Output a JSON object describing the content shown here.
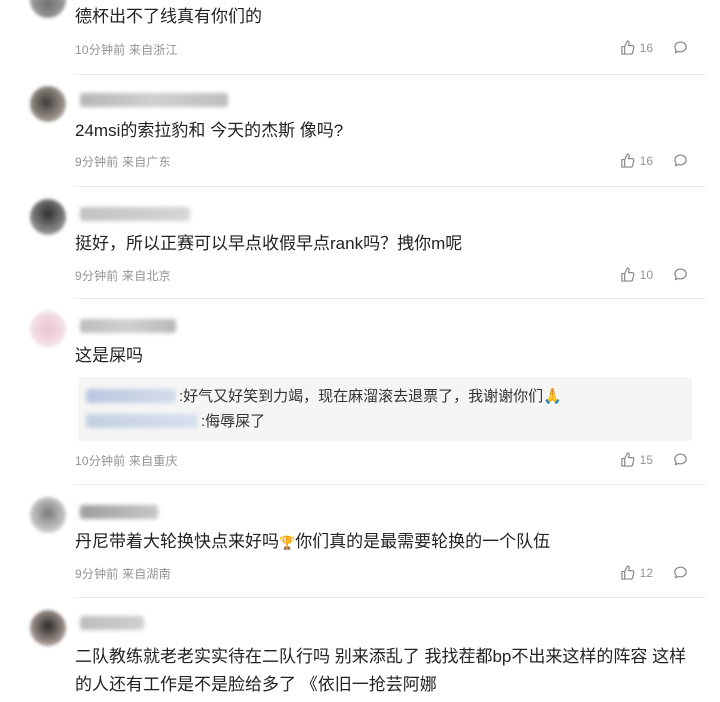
{
  "colors": {
    "meta_text": "#939393",
    "divider": "#ececec",
    "quote_bg": "#f5f5f5"
  },
  "icons": {
    "like": "thumbs-up-icon",
    "reply": "comment-bubble-icon"
  },
  "comments": [
    {
      "text": "德杯出不了线真有你们的",
      "time": "10分钟前",
      "location": "来自浙江",
      "likes": "16"
    },
    {
      "text": "24msi的索拉豹和 今天的杰斯 像吗?",
      "time": "9分钟前",
      "location": "来自广东",
      "likes": "16"
    },
    {
      "text": "挺好，所以正赛可以早点收假早点rank吗？拽你m呢",
      "time": "9分钟前",
      "location": "来自北京",
      "likes": "10"
    },
    {
      "text": "这是屎吗",
      "time": "10分钟前",
      "location": "来自重庆",
      "likes": "15",
      "replies": [
        {
          "text": ":好气又好笑到力竭，现在麻溜滚去退票了，我谢谢你们🙏"
        },
        {
          "text": ":侮辱屎了"
        }
      ]
    },
    {
      "text": "丹尼带着大轮换快点来好吗",
      "text2": "你们真的是最需要轮换的一个队伍",
      "time": "9分钟前",
      "location": "来自湖南",
      "likes": "12"
    },
    {
      "text": "二队教练就老老实实待在二队行吗 别来添乱了 我找茬都bp不出来这样的阵容 这样的人还有工作是不是脸给多了 《依旧一抢芸阿娜"
    }
  ]
}
